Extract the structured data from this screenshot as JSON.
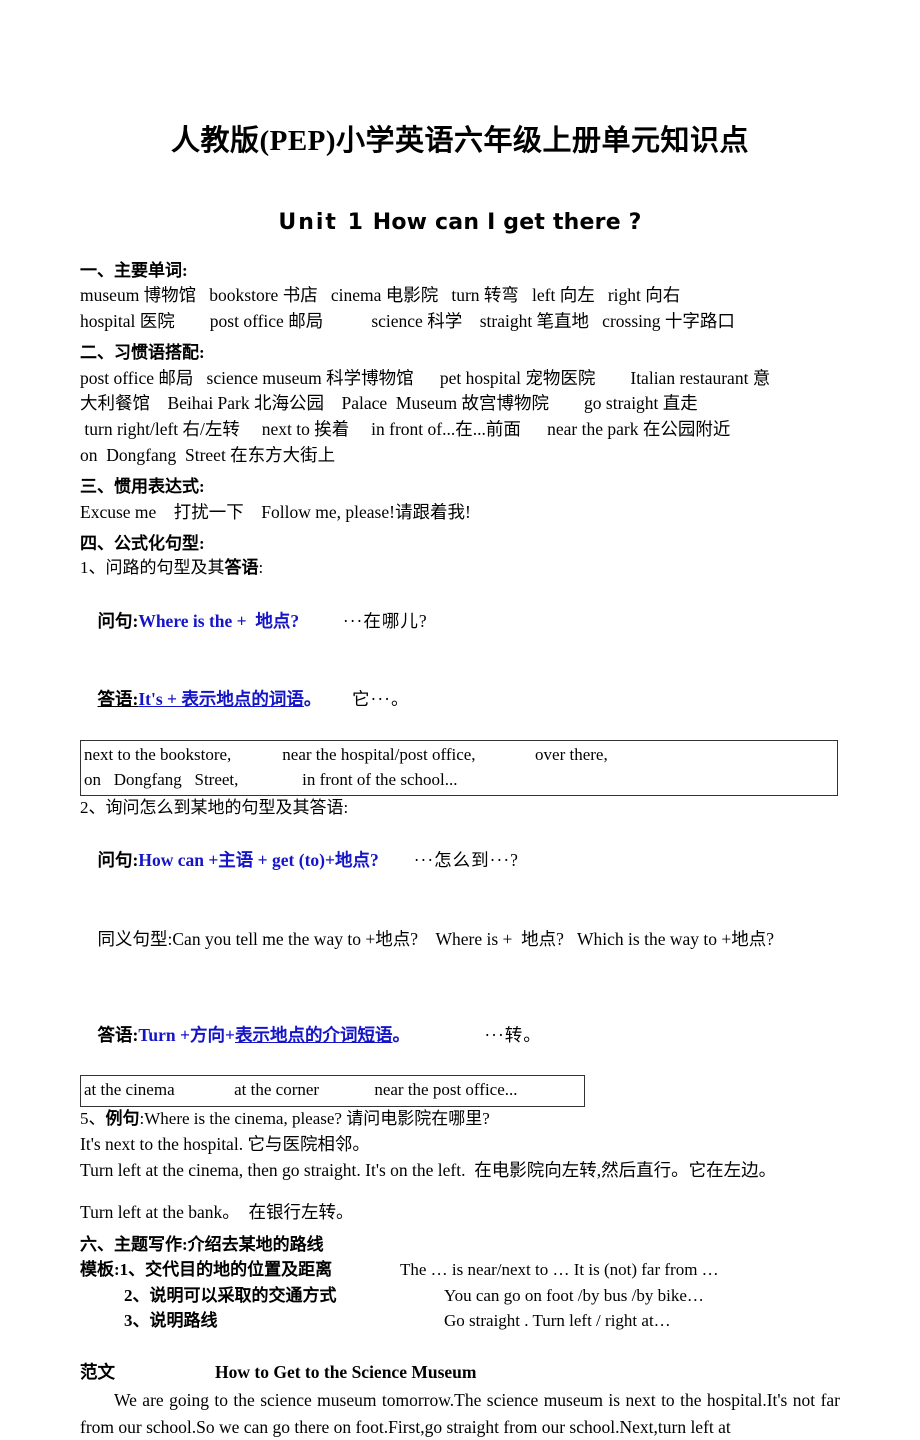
{
  "document": {
    "title": "人教版(PEP)小学英语六年级上册单元知识点",
    "unit_title_a": "Unit 1",
    "unit_title_b": "How can I get there ?"
  },
  "sections": {
    "vocabulary": {
      "heading": "一、主要单词:",
      "lines": [
        "museum 博物馆   bookstore 书店   cinema 电影院   turn 转弯   left 向左   right 向右",
        "hospital 医院        post office 邮局           science 科学    straight 笔直地   crossing 十字路口"
      ]
    },
    "collocations": {
      "heading": "二、习惯语搭配:",
      "lines": [
        "post office 邮局   science museum 科学博物馆      pet hospital 宠物医院        Italian restaurant 意",
        "大利餐馆    Beihai Park 北海公园    Palace  Museum 故宫博物院        go straight 直走",
        " turn right/left 右/左转     next to 挨着     in front of...在...前面      near the park 在公园附近",
        "on  Dongfang  Street 在东方大街上"
      ]
    },
    "expressions": {
      "heading": "三、惯用表达式:",
      "lines": [
        "Excuse me    打扰一下    Follow me, please!请跟着我!"
      ]
    },
    "patterns": {
      "heading": "四、公式化句型:",
      "item1": {
        "label_a": "1、问路的句型及其",
        "label_b": "答语",
        "label_c": ":",
        "question_label": "问句:",
        "question_formula": "Where is the +  地点?",
        "question_meaning": "···在哪儿?",
        "answer_label": "答语:",
        "answer_formula_a": "It's + ",
        "answer_formula_b": "表示地点的词语",
        "answer_formula_c": "。",
        "answer_meaning": "它···。",
        "box_lines": [
          "next to the bookstore,            near the hospital/post office,              over there,",
          "on   Dongfang   Street,               in front of the school..."
        ]
      },
      "item2": {
        "label": "2、询问怎么到某地的句型及其答语:",
        "question_label": "问句:",
        "question_formula": "How can +主语 + get (to)+地点?",
        "question_meaning": "···怎么到···?",
        "synonym_label": "同义句型:",
        "synonym_text": "Can you tell me the way to +地点?    Where is +  地点?   Which is the way to +地点?",
        "answer_label": "答语:",
        "answer_formula_a": "Turn +方向+",
        "answer_formula_b": "表示地点的介词短语",
        "answer_formula_c": "。",
        "answer_meaning": "···转。",
        "box_lines": [
          "at the cinema              at the corner             near the post office..."
        ]
      },
      "item5": {
        "label_a": "5、",
        "label_b": "例句",
        "label_c": ":Where is the cinema, please? 请问电影院在哪里?",
        "lines": [
          "It's next to the hospital. 它与医院相邻。",
          "Turn left at the cinema, then go straight. It's on the left.  在电影院向左转,然后直行。它在左边。"
        ],
        "extra_line": "Turn left at the bank。  在银行左转。"
      }
    },
    "writing": {
      "heading": "六、主题写作:介绍去某地的路线",
      "rows": [
        {
          "left": "模板:1、交代目的地的位置及距离",
          "right": "The … is near/next to … It is (not) far from …",
          "indent": false
        },
        {
          "left": "2、说明可以采取的交通方式",
          "right": "You can go on foot /by bus /by bike…",
          "indent": true
        },
        {
          "left": "3、说明路线",
          "right": "Go straight . Turn left / right at…",
          "indent": true
        }
      ]
    },
    "sample": {
      "label": "范文",
      "title": "How to Get to the Science Museum",
      "body": "We are going to the science museum tomorrow.The science museum is next to the hospital.It's not far from our school.So we can go there on foot.First,go straight from our school.Next,turn left at"
    }
  },
  "colors": {
    "formula_blue": "#1414c8",
    "text_black": "#000000",
    "box_border": "#333333"
  }
}
